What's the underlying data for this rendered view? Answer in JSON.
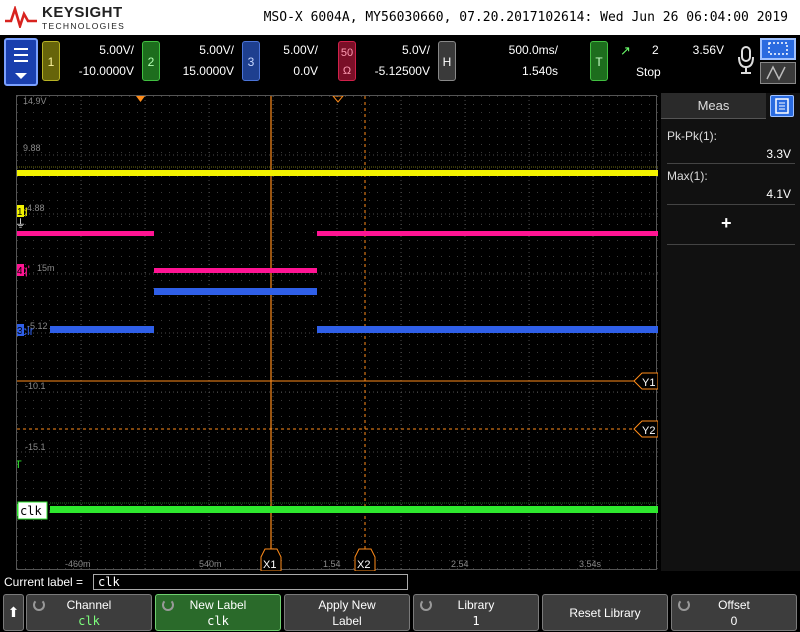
{
  "banner": {
    "brand": "KEYSIGHT",
    "brand_sub": "TECHNOLOGIES",
    "info": "MSO-X 6004A, MY56030660, 07.20.2017102614: Wed Jun 26 06:04:00 2019"
  },
  "channels": {
    "ch1": {
      "num": "1",
      "scale": "5.00V/",
      "offset": "-10.0000V",
      "color": "#f2f200"
    },
    "ch2": {
      "num": "2",
      "scale": "5.00V/",
      "offset": "15.0000V",
      "color": "#2ee82e"
    },
    "ch3": {
      "num": "3",
      "scale": "5.00V/",
      "offset": "0.0V",
      "color": "#2f5fe8"
    },
    "ch4": {
      "num": "50 Ω",
      "scale": "5.0V/",
      "offset": "-5.12500V",
      "color": "#ff1493"
    }
  },
  "horizontal": {
    "tag": "H",
    "timebase": "500.0ms/",
    "delay": "1.540s"
  },
  "trigger": {
    "tag": "T",
    "slope": "↗",
    "source": "2",
    "level": "3.56V",
    "mode": "Stop"
  },
  "scope": {
    "y_labels": [
      "14.9V",
      "9.88",
      "4.88",
      "15m",
      "-5.12",
      "-10.1",
      "-15.1"
    ],
    "x_labels": [
      "-460m",
      "540m",
      "1.54",
      "2.54",
      "3.54s"
    ],
    "channel_labels": [
      {
        "marker": "1",
        "text": "d"
      },
      {
        "marker": "4",
        "text": "q'"
      },
      {
        "marker": "3",
        "text": "clr"
      },
      {
        "marker": "2",
        "text": "clk"
      }
    ],
    "cursor_markers": {
      "x1": "X1",
      "x2": "X2",
      "y1": "Y1",
      "y2": "Y2"
    },
    "trigger_marker": "T",
    "ground_marker": "⏚"
  },
  "meas": {
    "title": "Meas",
    "items": [
      {
        "label": "Pk-Pk(1):",
        "value": "3.3V"
      },
      {
        "label": "Max(1):",
        "value": "4.1V"
      }
    ],
    "add_symbol": "+"
  },
  "label_bar": {
    "caption": "Current label =",
    "value": "clk"
  },
  "softkeys": [
    {
      "title": "Channel",
      "value": "clk"
    },
    {
      "title": "New Label",
      "value": "clk"
    },
    {
      "title": "Apply New",
      "value": "Label"
    },
    {
      "title": "Library",
      "value": "1"
    },
    {
      "title": "Reset Library",
      "value": ""
    },
    {
      "title": "Offset",
      "value": "0"
    }
  ],
  "softkey_up_glyph": "⬆"
}
